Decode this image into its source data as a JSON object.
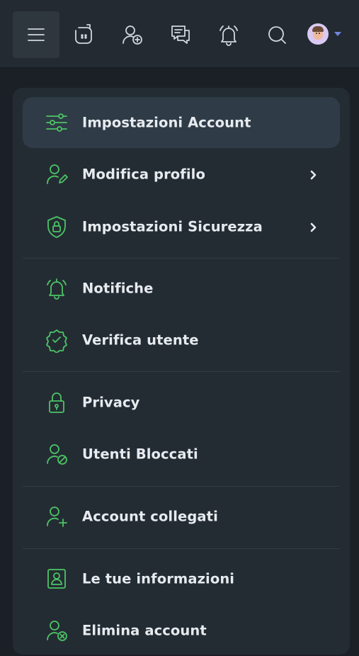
{
  "topbar": {
    "icons": [
      "menu-icon",
      "stories-icon",
      "add-friend-icon",
      "messages-icon",
      "notifications-icon",
      "search-icon"
    ],
    "avatar": "user-avatar",
    "accent": "#6f86e0"
  },
  "colors": {
    "icon_green": "#4cc466",
    "panel_bg": "#242c33",
    "active_bg": "#2f3b46"
  },
  "menu": {
    "items": [
      {
        "label": "Impostazioni Account",
        "icon": "sliders-icon",
        "active": true
      },
      {
        "label": "Modifica profilo",
        "icon": "user-edit-icon",
        "chevron": true
      },
      {
        "label": "Impostazioni Sicurezza",
        "icon": "shield-lock-icon",
        "chevron": true
      },
      {
        "label": "Notifiche",
        "icon": "bell-icon"
      },
      {
        "label": "Verifica utente",
        "icon": "verified-badge-icon"
      },
      {
        "label": "Privacy",
        "icon": "lock-icon"
      },
      {
        "label": "Utenti Bloccati",
        "icon": "user-blocked-icon"
      },
      {
        "label": "Account collegati",
        "icon": "user-plus-icon"
      },
      {
        "label": "Le tue informazioni",
        "icon": "id-card-icon"
      },
      {
        "label": "Elimina account",
        "icon": "user-delete-icon"
      }
    ]
  }
}
